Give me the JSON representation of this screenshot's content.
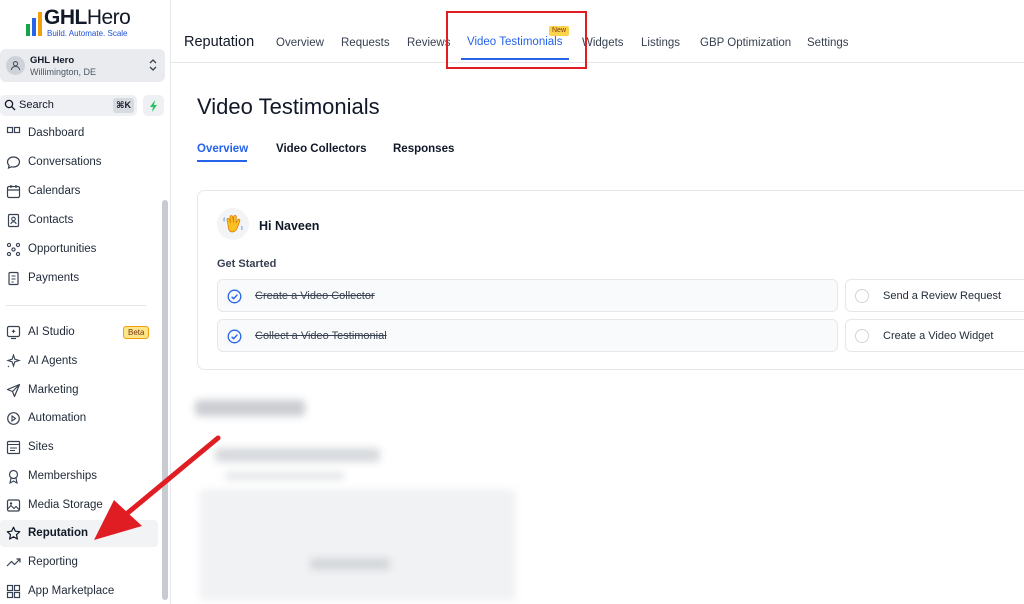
{
  "brand": {
    "name_bold": "GHL",
    "name_light": "Hero",
    "tagline": "Build. Automate. Scale"
  },
  "account": {
    "name": "GHL Hero",
    "location": "Willimington, DE"
  },
  "search": {
    "label": "Search",
    "shortcut": "⌘K"
  },
  "sidebar": {
    "items": [
      {
        "label": "Dashboard",
        "icon": "dashboard-icon"
      },
      {
        "label": "Conversations",
        "icon": "chat-bubble-icon"
      },
      {
        "label": "Calendars",
        "icon": "calendar-icon"
      },
      {
        "label": "Contacts",
        "icon": "contacts-icon"
      },
      {
        "label": "Opportunities",
        "icon": "opportunities-icon"
      },
      {
        "label": "Payments",
        "icon": "payments-icon"
      },
      {
        "label": "AI Studio",
        "icon": "ai-studio-icon",
        "badge": "Beta"
      },
      {
        "label": "AI Agents",
        "icon": "sparkle-icon"
      },
      {
        "label": "Marketing",
        "icon": "send-icon"
      },
      {
        "label": "Automation",
        "icon": "automation-icon"
      },
      {
        "label": "Sites",
        "icon": "sites-icon"
      },
      {
        "label": "Memberships",
        "icon": "badge-icon"
      },
      {
        "label": "Media Storage",
        "icon": "image-icon"
      },
      {
        "label": "Reputation",
        "icon": "star-icon",
        "active": true
      },
      {
        "label": "Reporting",
        "icon": "trend-icon"
      },
      {
        "label": "App Marketplace",
        "icon": "grid-icon"
      }
    ]
  },
  "topnav": {
    "section": "Reputation",
    "tabs": [
      {
        "label": "Overview"
      },
      {
        "label": "Requests"
      },
      {
        "label": "Reviews"
      },
      {
        "label": "Video Testimonials",
        "active": true,
        "badge": "New"
      },
      {
        "label": "Widgets"
      },
      {
        "label": "Listings"
      },
      {
        "label": "GBP Optimization"
      },
      {
        "label": "Settings"
      }
    ]
  },
  "main": {
    "title": "Video Testimonials",
    "subtabs": [
      {
        "label": "Overview",
        "active": true
      },
      {
        "label": "Video Collectors"
      },
      {
        "label": "Responses"
      }
    ],
    "greeting": "Hi Naveen",
    "get_started": "Get Started",
    "tasks": [
      {
        "label": "Create a Video Collector",
        "done": true
      },
      {
        "label": "Collect a Video Testimonial",
        "done": true
      },
      {
        "label": "Send a Review Request",
        "done": false
      },
      {
        "label": "Create a Video Widget",
        "done": false
      }
    ]
  },
  "colors": {
    "accent": "#2563eb",
    "highlight": "#e11d24",
    "arrow": "#e11d24"
  }
}
